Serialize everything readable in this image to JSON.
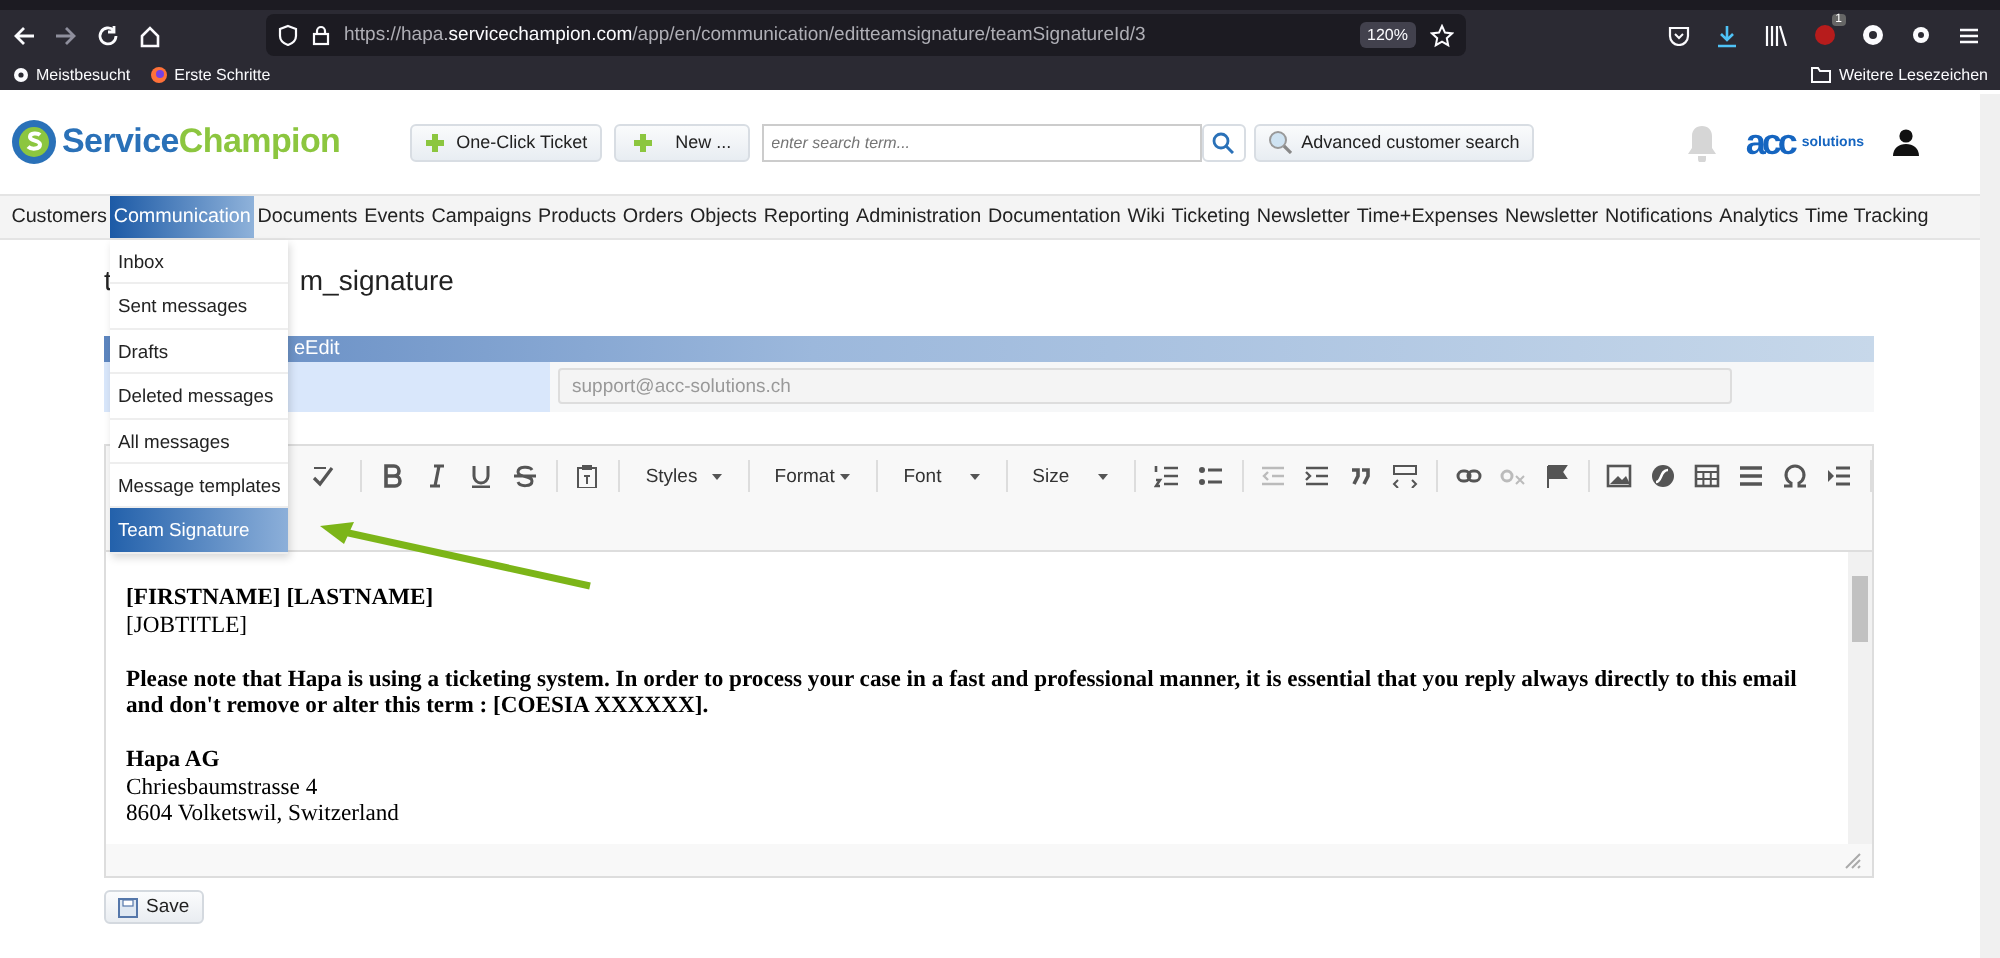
{
  "browser": {
    "url_prefix": "https://hapa.",
    "url_domain": "servicechampion.com",
    "url_path": "/app/en/communication/editteamsignature/teamSignatureId/3",
    "zoom": "120%",
    "extension_badge": "1",
    "bookmarks": [
      "Meistbesucht",
      "Erste Schritte"
    ],
    "other_bookmarks": "Weitere Lesezeichen"
  },
  "header": {
    "logo_first": "Service",
    "logo_second": "Champion",
    "buttons": [
      "One-Click Ticket",
      "New ..."
    ],
    "search": {
      "placeholder": "enter search term..."
    },
    "advanced_search": "Advanced customer search",
    "company_logo": "acc",
    "company_logo_suffix": "solutions"
  },
  "nav": [
    {
      "label": "Customers",
      "selected": false
    },
    {
      "label": "Communication",
      "selected": true
    },
    {
      "label": "Documents",
      "selected": false
    },
    {
      "label": "Events",
      "selected": false
    },
    {
      "label": "Campaigns",
      "selected": false
    },
    {
      "label": "Products",
      "selected": false
    },
    {
      "label": "Orders",
      "selected": false
    },
    {
      "label": "Objects",
      "selected": false
    },
    {
      "label": "Reporting",
      "selected": false
    },
    {
      "label": "Administration",
      "selected": false
    },
    {
      "label": "Documentation",
      "selected": false
    },
    {
      "label": "Wiki",
      "selected": false
    },
    {
      "label": "Ticketing",
      "selected": false
    },
    {
      "label": "Newsletter",
      "selected": false
    },
    {
      "label": "Time+Expenses",
      "selected": false
    },
    {
      "label": "Newsletter",
      "selected": false
    },
    {
      "label": "Notifications",
      "selected": false
    },
    {
      "label": "Analytics",
      "selected": false
    },
    {
      "label": "Time Tracking",
      "selected": false
    }
  ],
  "menu": [
    {
      "label": "Inbox",
      "selected": false
    },
    {
      "label": "Sent messages",
      "selected": false
    },
    {
      "label": "Drafts",
      "selected": false
    },
    {
      "label": "Deleted messages",
      "selected": false
    },
    {
      "label": "All messages",
      "selected": false
    },
    {
      "label": "Message templates",
      "selected": false
    },
    {
      "label": "Team Signature",
      "selected": true
    }
  ],
  "page": {
    "title_start": "t",
    "title_end": "m_signature",
    "panel_header": "eEdit",
    "sender_field": {
      "value": "support@acc-solutions.ch",
      "disabled": true
    },
    "editor": {
      "dropdowns": [
        "Styles",
        "Format",
        "Font",
        "Size"
      ],
      "lines": [
        {
          "kind": "bold",
          "text": "[FIRSTNAME] [LASTNAME]"
        },
        {
          "kind": "plain",
          "text": "[JOBTITLE]"
        },
        {
          "kind": "gap"
        },
        {
          "kind": "bold",
          "text": "Please note that Hapa is using a ticketing system. In order to process your case in a fast and professional manner, it is essential that you reply always directly to this email and don't remove or alter this term : [COESIA XXXXXX]."
        },
        {
          "kind": "gap"
        },
        {
          "kind": "bold",
          "text": "Hapa AG"
        },
        {
          "kind": "plain",
          "text": "Chriesbaumstrasse 4"
        },
        {
          "kind": "plain",
          "text": "8604 Volketswil, Switzerland"
        }
      ]
    },
    "save_button": "Save"
  }
}
